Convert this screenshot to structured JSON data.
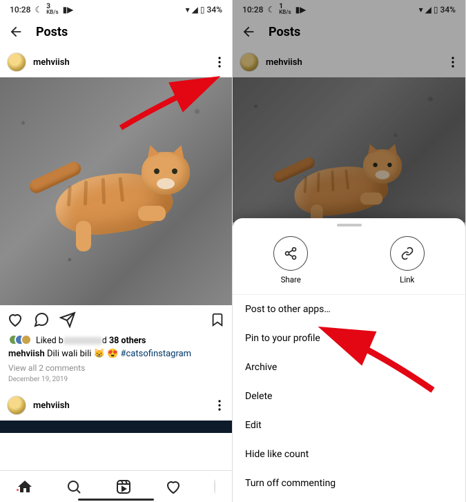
{
  "status": {
    "time": "10:28",
    "kbs_left": "3",
    "kbs_right": "1",
    "kbs_unit": "KB/s",
    "battery": "34%"
  },
  "header": {
    "title": "Posts"
  },
  "post": {
    "username": "mehviish",
    "likes_prefix": "Liked b",
    "likes_mid": "d",
    "likes_suffix": "38 others",
    "caption_user": "mehviish",
    "caption_text": "Dili wali bili",
    "caption_emojis": "😸 😍",
    "caption_hashtag": "#catsofinstagram",
    "comments": "View all 2 comments",
    "date": "December 19, 2019"
  },
  "sheet": {
    "share": "Share",
    "link": "Link",
    "items": [
      "Post to other apps…",
      "Pin to your profile",
      "Archive",
      "Delete",
      "Edit",
      "Hide like count",
      "Turn off commenting"
    ]
  }
}
